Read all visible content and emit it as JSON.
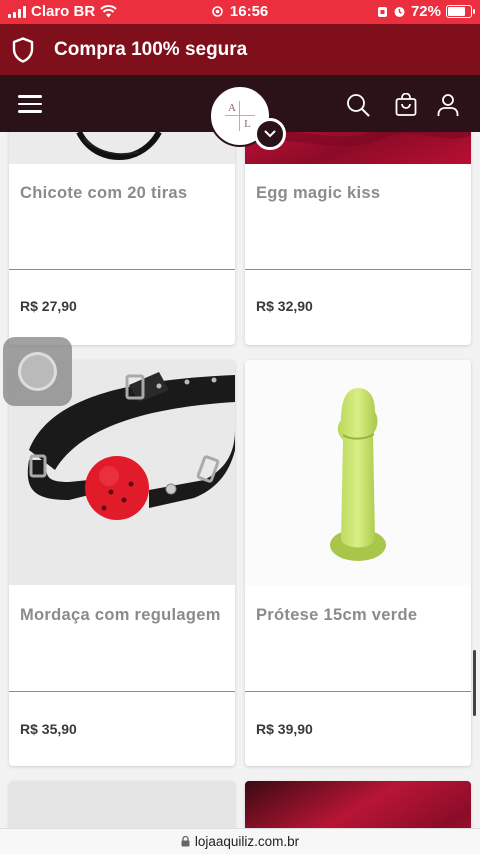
{
  "status": {
    "carrier": "Claro BR",
    "time": "16:56",
    "battery": "72%"
  },
  "banner": {
    "text": "Compra 100% segura",
    "icon": "shield-icon"
  },
  "nav": {
    "logo_letters": [
      "A",
      "",
      "",
      "L"
    ],
    "icons": [
      "menu-icon",
      "search-icon",
      "bag-icon",
      "user-icon"
    ]
  },
  "products": [
    {
      "title": "Chicote com 20 tiras",
      "price": "R$ 27,90"
    },
    {
      "title": "Egg magic kiss",
      "price": "R$ 32,90"
    },
    {
      "title": "Mordaça com regulagem",
      "price": "R$ 35,90"
    },
    {
      "title": "Prótese 15cm verde",
      "price": "R$ 39,90"
    }
  ],
  "url": "lojaaquiliz.com.br",
  "colors": {
    "status_bar": "#ec2f3e",
    "banner": "#7f0f1a",
    "nav": "#2a1218",
    "title_text": "#8b8b8b",
    "price_text": "#3a3a3a"
  }
}
